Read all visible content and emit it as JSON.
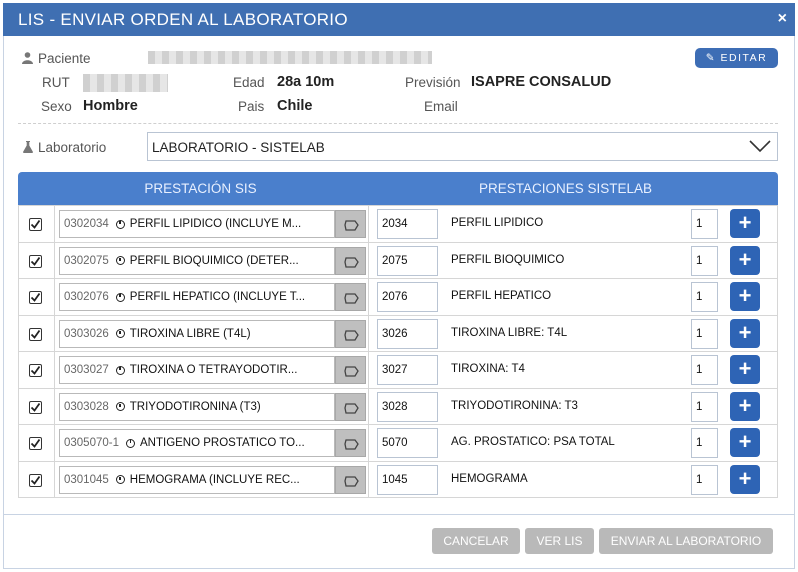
{
  "window": {
    "title": "LIS - ENVIAR ORDEN AL LABORATORIO",
    "close_label": "×"
  },
  "patient": {
    "label_paciente": "Paciente",
    "edit_label": "EDITAR",
    "label_rut": "RUT",
    "label_edad": "Edad",
    "edad": "28a 10m",
    "label_prevision": "Previsión",
    "prevision": "ISAPRE CONSALUD",
    "label_sexo": "Sexo",
    "sexo": "Hombre",
    "label_pais": "Pais",
    "pais": "Chile",
    "label_email": "Email"
  },
  "lab": {
    "label": "Laboratorio",
    "selected": "LABORATORIO - SISTELAB"
  },
  "table": {
    "header_sis": "PRESTACIÓN SIS",
    "header_sistelab": "PRESTACIONES SISTELAB",
    "rows": [
      {
        "sis_code": "0302034",
        "sis_name": "PERFIL LIPIDICO (INCLUYE M...",
        "code": "2034",
        "name": "PERFIL LIPIDICO",
        "qty": "1"
      },
      {
        "sis_code": "0302075",
        "sis_name": "PERFIL BIOQUIMICO (DETER...",
        "code": "2075",
        "name": "PERFIL BIOQUIMICO",
        "qty": "1"
      },
      {
        "sis_code": "0302076",
        "sis_name": "PERFIL HEPATICO (INCLUYE T...",
        "code": "2076",
        "name": "PERFIL HEPATICO",
        "qty": "1"
      },
      {
        "sis_code": "0303026",
        "sis_name": "TIROXINA LIBRE (T4L)",
        "code": "3026",
        "name": "TIROXINA LIBRE: T4L",
        "qty": "1"
      },
      {
        "sis_code": "0303027",
        "sis_name": "TIROXINA O TETRAYODOTIR...",
        "code": "3027",
        "name": "TIROXINA: T4",
        "qty": "1"
      },
      {
        "sis_code": "0303028",
        "sis_name": "TRIYODOTIRONINA (T3)",
        "code": "3028",
        "name": "TRIYODOTIRONINA: T3",
        "qty": "1"
      },
      {
        "sis_code": "0305070-1",
        "sis_name": "ANTIGENO PROSTATICO TO...",
        "code": "5070",
        "name": "AG. PROSTATICO: PSA TOTAL",
        "qty": "1"
      },
      {
        "sis_code": "0301045",
        "sis_name": "HEMOGRAMA (INCLUYE REC...",
        "code": "1045",
        "name": "HEMOGRAMA",
        "qty": "1"
      }
    ]
  },
  "footer": {
    "cancel": "CANCELAR",
    "view": "VER LIS",
    "send": "ENVIAR AL LABORATORIO"
  },
  "colors": {
    "title_bar": "#3f6fb2",
    "header": "#4a7fcc",
    "add_button": "#2e64b5",
    "disabled_button": "#b9b9b9"
  }
}
